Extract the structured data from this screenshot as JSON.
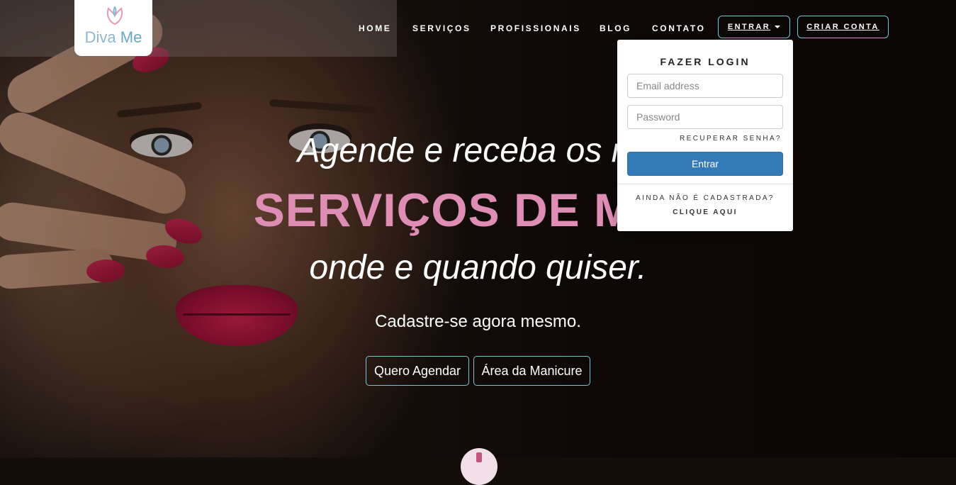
{
  "brand": {
    "name_part1": "Diva",
    "name_part2": "Me",
    "logo_icon": "tulip-icon",
    "accent_color": "#de8db4",
    "secondary_color": "#7fc0d8"
  },
  "nav": {
    "items": [
      {
        "label": "HOME"
      },
      {
        "label": "SERVIÇOS"
      },
      {
        "label": "PROFISSIONAIS"
      },
      {
        "label": "BLOG"
      },
      {
        "label": "CONTATO"
      }
    ],
    "login_label": "ENTRAR",
    "signup_label": "CRIAR CONTA"
  },
  "hero": {
    "line1": "Agende e receba os me",
    "line2": "SERVIÇOS DE MAN",
    "line3": "onde e quando quiser.",
    "line4": "Cadastre-se agora mesmo.",
    "cta_primary": "Quero Agendar",
    "cta_secondary": "Área da Manicure"
  },
  "login": {
    "title": "FAZER LOGIN",
    "email_placeholder": "Email address",
    "password_placeholder": "Password",
    "recover": "RECUPERAR SENHA?",
    "submit": "Entrar",
    "not_registered": "AINDA NÃO É CADASTRADA?",
    "click_here": "CLIQUE AQUI",
    "submit_color": "#337ab7"
  }
}
